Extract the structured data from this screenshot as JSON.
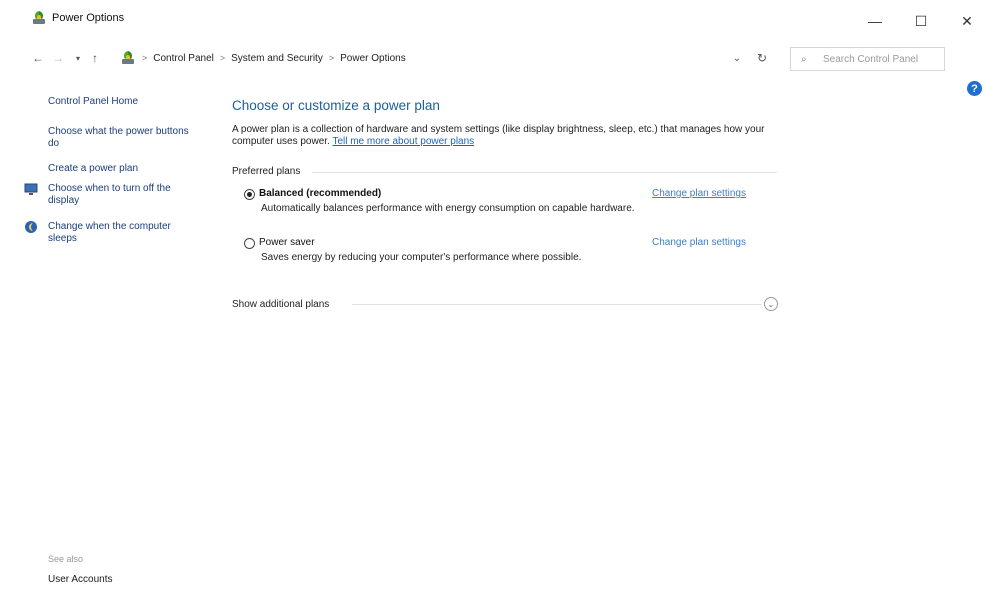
{
  "window": {
    "title": "Power Options",
    "minimize_glyph": "—",
    "maximize_glyph": "☐",
    "close_glyph": "✕"
  },
  "nav": {
    "back_glyph": "←",
    "forward_glyph": "→",
    "recent_glyph": "▾",
    "up_glyph": "↑"
  },
  "breadcrumbs": [
    {
      "label": "Control Panel"
    },
    {
      "label": "System and Security"
    },
    {
      "label": "Power Options"
    }
  ],
  "address": {
    "separator": ">",
    "dropdown_glyph": "⌄",
    "refresh_glyph": "↻"
  },
  "search": {
    "placeholder": "Search Control Panel",
    "icon_glyph": "⌕"
  },
  "help": {
    "glyph": "?"
  },
  "sidebar": {
    "home": "Control Panel Home",
    "links": [
      {
        "label": "Choose what the power buttons do"
      },
      {
        "label": "Create a power plan"
      },
      {
        "label": "Choose when to turn off the display"
      },
      {
        "label": "Change when the computer sleeps"
      }
    ],
    "see_also": "See also",
    "user_accounts": "User Accounts"
  },
  "main": {
    "title": "Choose or customize a power plan",
    "description": "A power plan is a collection of hardware and system settings (like display brightness, sleep, etc.) that manages how your computer uses power.",
    "description_link": "Tell me more about power plans",
    "section_label": "Preferred plans",
    "plans": [
      {
        "name": "Balanced (recommended)",
        "description": "Automatically balances performance with energy consumption on capable hardware.",
        "change_link": "Change plan settings",
        "selected": true
      },
      {
        "name": "Power saver",
        "description": "Saves energy by reducing your computer's performance where possible.",
        "change_link": "Change plan settings",
        "selected": false
      }
    ],
    "additional_plans": "Show additional plans",
    "expand_glyph": "⌄"
  },
  "colors": {
    "title_blue": "#1c5f9c",
    "link_blue": "#1e63b8",
    "sidebar_link": "#1b3d7a",
    "help_blue": "#1f6fd1"
  }
}
